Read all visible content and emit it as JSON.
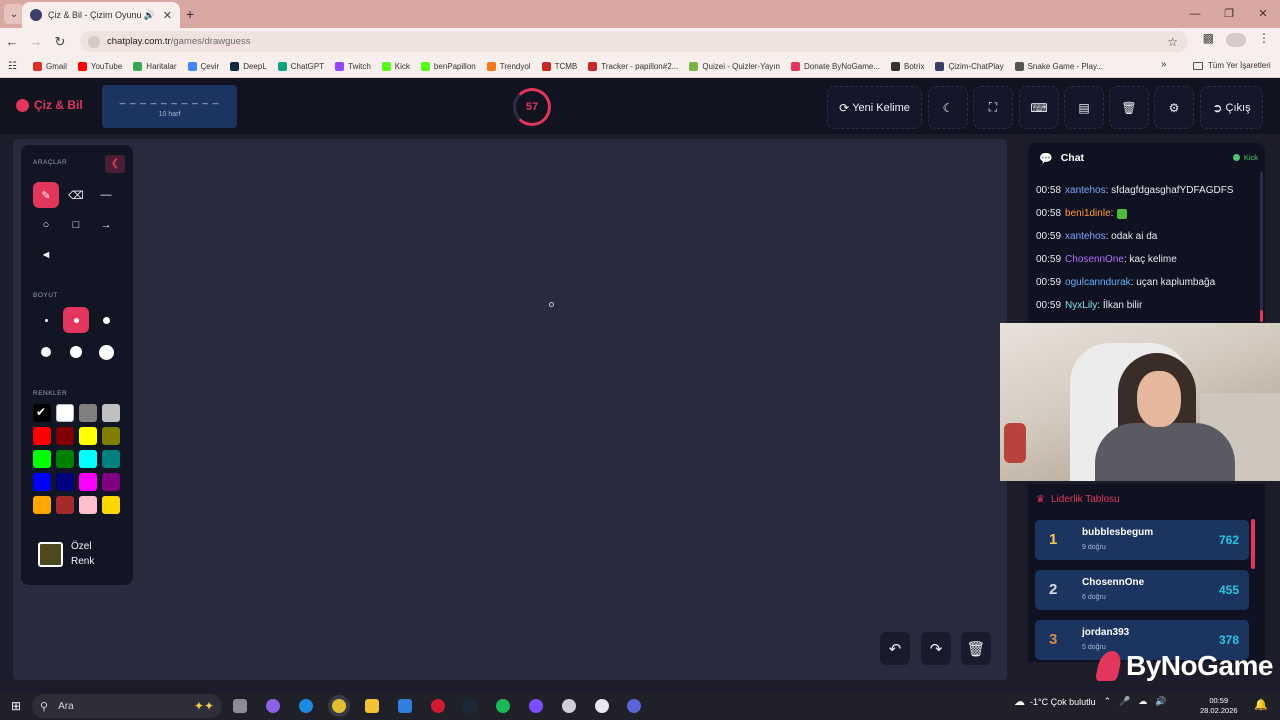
{
  "browser": {
    "tab_title": "Çiz & Bil - Çizim Oyunu",
    "url_host": "chatplay.com.tr",
    "url_path": "/games/drawguess",
    "bookmarks": [
      "Gmail",
      "YouTube",
      "Haritalar",
      "Çevir",
      "DeepL",
      "ChatGPT",
      "Twitch",
      "Kick",
      "benPapillon",
      "Trendyol",
      "TCMB",
      "Tracker - papillon#2...",
      "Quizei - Quizler-Yayın",
      "Donate ByNoGame...",
      "Botrix",
      "Çizim-ChatPlay",
      "Snake Game - Play..."
    ],
    "bookmark_colors": [
      "#d93025",
      "#ff0000",
      "#34a853",
      "#4285f4",
      "#0f2b46",
      "#10a37f",
      "#9146ff",
      "#53fc18",
      "#53fc18",
      "#f27a1a",
      "#c62828",
      "#c62828",
      "#7cb342",
      "#e3365c",
      "#333333",
      "#3b3f6b",
      "#555555"
    ],
    "all_bookmarks": "Tüm Yer İşaretleri"
  },
  "header": {
    "logo": "Çiz & Bil",
    "word_mask": "_ _ _ _ _ _ _ _ _ _",
    "word_hint": "10 harf",
    "timer": "57",
    "new_word": "Yeni Kelime",
    "exit": "Çıkış"
  },
  "tools": {
    "section_tools": "ARAÇLAR",
    "section_size": "BOYUT",
    "section_colors": "RENKLER",
    "custom_color_line1": "Özel",
    "custom_color_line2": "Renk",
    "custom_color": "#4c4a1e",
    "active_tool": "pen",
    "active_size_index": 1,
    "selected_color_index": 0,
    "colors": [
      "#000000",
      "#ffffff",
      "#808080",
      "#c0c0c0",
      "#ff0000",
      "#800000",
      "#ffff00",
      "#808000",
      "#00ff00",
      "#008000",
      "#00ffff",
      "#008080",
      "#0000ff",
      "#000080",
      "#ff00ff",
      "#800080",
      "#ffa500",
      "#a52a2a",
      "#ffc0cb",
      "#ffd700"
    ]
  },
  "chat": {
    "title": "Chat",
    "status": "Kick",
    "messages": [
      {
        "time": "00:58",
        "user": "xantehos",
        "user_color": "#7aa7ff",
        "text": ": sfdagfdgasghafYDFAGDFS"
      },
      {
        "time": "00:58",
        "user": "beni1dinle",
        "user_color": "#ff9a3c",
        "text": ":"
      },
      {
        "time": "00:59",
        "user": "xantehos",
        "user_color": "#7aa7ff",
        "text": ": odak ai da"
      },
      {
        "time": "00:59",
        "user": "ChosennOne",
        "user_color": "#b06cff",
        "text": ": kaç kelime"
      },
      {
        "time": "00:59",
        "user": "ogulcanndurak",
        "user_color": "#5fb0ff",
        "text": ": uçan kaplumbağa"
      },
      {
        "time": "00:59",
        "user": "NyxLily",
        "user_color": "#7fe0e8",
        "text": ": İlkan bilir"
      }
    ]
  },
  "leaderboard": {
    "title": "Liderlik Tablosu",
    "rows": [
      {
        "rank": "1",
        "rank_color": "#f6c94a",
        "name": "bubblesbegum",
        "correct": "9 doğru",
        "score": "762"
      },
      {
        "rank": "2",
        "rank_color": "#d7dbe6",
        "name": "ChosennOne",
        "correct": "6 doğru",
        "score": "455"
      },
      {
        "rank": "3",
        "rank_color": "#d9894a",
        "name": "jordan393",
        "correct": "5 doğru",
        "score": "378"
      }
    ]
  },
  "watermark": "ByNoGame",
  "taskbar": {
    "search": "Ara",
    "weather": "-1°C  Çok bulutlu",
    "time": "00:59",
    "date": "28.02.2026"
  }
}
